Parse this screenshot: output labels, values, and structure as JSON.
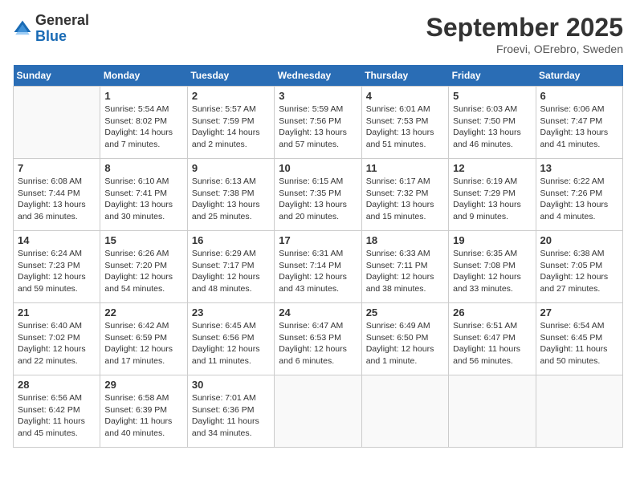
{
  "header": {
    "logo_general": "General",
    "logo_blue": "Blue",
    "month_title": "September 2025",
    "subtitle": "Froevi, OErebro, Sweden"
  },
  "days_of_week": [
    "Sunday",
    "Monday",
    "Tuesday",
    "Wednesday",
    "Thursday",
    "Friday",
    "Saturday"
  ],
  "weeks": [
    [
      {
        "day": "",
        "sunrise": "",
        "sunset": "",
        "daylight": ""
      },
      {
        "day": "1",
        "sunrise": "Sunrise: 5:54 AM",
        "sunset": "Sunset: 8:02 PM",
        "daylight": "Daylight: 14 hours and 7 minutes."
      },
      {
        "day": "2",
        "sunrise": "Sunrise: 5:57 AM",
        "sunset": "Sunset: 7:59 PM",
        "daylight": "Daylight: 14 hours and 2 minutes."
      },
      {
        "day": "3",
        "sunrise": "Sunrise: 5:59 AM",
        "sunset": "Sunset: 7:56 PM",
        "daylight": "Daylight: 13 hours and 57 minutes."
      },
      {
        "day": "4",
        "sunrise": "Sunrise: 6:01 AM",
        "sunset": "Sunset: 7:53 PM",
        "daylight": "Daylight: 13 hours and 51 minutes."
      },
      {
        "day": "5",
        "sunrise": "Sunrise: 6:03 AM",
        "sunset": "Sunset: 7:50 PM",
        "daylight": "Daylight: 13 hours and 46 minutes."
      },
      {
        "day": "6",
        "sunrise": "Sunrise: 6:06 AM",
        "sunset": "Sunset: 7:47 PM",
        "daylight": "Daylight: 13 hours and 41 minutes."
      }
    ],
    [
      {
        "day": "7",
        "sunrise": "Sunrise: 6:08 AM",
        "sunset": "Sunset: 7:44 PM",
        "daylight": "Daylight: 13 hours and 36 minutes."
      },
      {
        "day": "8",
        "sunrise": "Sunrise: 6:10 AM",
        "sunset": "Sunset: 7:41 PM",
        "daylight": "Daylight: 13 hours and 30 minutes."
      },
      {
        "day": "9",
        "sunrise": "Sunrise: 6:13 AM",
        "sunset": "Sunset: 7:38 PM",
        "daylight": "Daylight: 13 hours and 25 minutes."
      },
      {
        "day": "10",
        "sunrise": "Sunrise: 6:15 AM",
        "sunset": "Sunset: 7:35 PM",
        "daylight": "Daylight: 13 hours and 20 minutes."
      },
      {
        "day": "11",
        "sunrise": "Sunrise: 6:17 AM",
        "sunset": "Sunset: 7:32 PM",
        "daylight": "Daylight: 13 hours and 15 minutes."
      },
      {
        "day": "12",
        "sunrise": "Sunrise: 6:19 AM",
        "sunset": "Sunset: 7:29 PM",
        "daylight": "Daylight: 13 hours and 9 minutes."
      },
      {
        "day": "13",
        "sunrise": "Sunrise: 6:22 AM",
        "sunset": "Sunset: 7:26 PM",
        "daylight": "Daylight: 13 hours and 4 minutes."
      }
    ],
    [
      {
        "day": "14",
        "sunrise": "Sunrise: 6:24 AM",
        "sunset": "Sunset: 7:23 PM",
        "daylight": "Daylight: 12 hours and 59 minutes."
      },
      {
        "day": "15",
        "sunrise": "Sunrise: 6:26 AM",
        "sunset": "Sunset: 7:20 PM",
        "daylight": "Daylight: 12 hours and 54 minutes."
      },
      {
        "day": "16",
        "sunrise": "Sunrise: 6:29 AM",
        "sunset": "Sunset: 7:17 PM",
        "daylight": "Daylight: 12 hours and 48 minutes."
      },
      {
        "day": "17",
        "sunrise": "Sunrise: 6:31 AM",
        "sunset": "Sunset: 7:14 PM",
        "daylight": "Daylight: 12 hours and 43 minutes."
      },
      {
        "day": "18",
        "sunrise": "Sunrise: 6:33 AM",
        "sunset": "Sunset: 7:11 PM",
        "daylight": "Daylight: 12 hours and 38 minutes."
      },
      {
        "day": "19",
        "sunrise": "Sunrise: 6:35 AM",
        "sunset": "Sunset: 7:08 PM",
        "daylight": "Daylight: 12 hours and 33 minutes."
      },
      {
        "day": "20",
        "sunrise": "Sunrise: 6:38 AM",
        "sunset": "Sunset: 7:05 PM",
        "daylight": "Daylight: 12 hours and 27 minutes."
      }
    ],
    [
      {
        "day": "21",
        "sunrise": "Sunrise: 6:40 AM",
        "sunset": "Sunset: 7:02 PM",
        "daylight": "Daylight: 12 hours and 22 minutes."
      },
      {
        "day": "22",
        "sunrise": "Sunrise: 6:42 AM",
        "sunset": "Sunset: 6:59 PM",
        "daylight": "Daylight: 12 hours and 17 minutes."
      },
      {
        "day": "23",
        "sunrise": "Sunrise: 6:45 AM",
        "sunset": "Sunset: 6:56 PM",
        "daylight": "Daylight: 12 hours and 11 minutes."
      },
      {
        "day": "24",
        "sunrise": "Sunrise: 6:47 AM",
        "sunset": "Sunset: 6:53 PM",
        "daylight": "Daylight: 12 hours and 6 minutes."
      },
      {
        "day": "25",
        "sunrise": "Sunrise: 6:49 AM",
        "sunset": "Sunset: 6:50 PM",
        "daylight": "Daylight: 12 hours and 1 minute."
      },
      {
        "day": "26",
        "sunrise": "Sunrise: 6:51 AM",
        "sunset": "Sunset: 6:47 PM",
        "daylight": "Daylight: 11 hours and 56 minutes."
      },
      {
        "day": "27",
        "sunrise": "Sunrise: 6:54 AM",
        "sunset": "Sunset: 6:45 PM",
        "daylight": "Daylight: 11 hours and 50 minutes."
      }
    ],
    [
      {
        "day": "28",
        "sunrise": "Sunrise: 6:56 AM",
        "sunset": "Sunset: 6:42 PM",
        "daylight": "Daylight: 11 hours and 45 minutes."
      },
      {
        "day": "29",
        "sunrise": "Sunrise: 6:58 AM",
        "sunset": "Sunset: 6:39 PM",
        "daylight": "Daylight: 11 hours and 40 minutes."
      },
      {
        "day": "30",
        "sunrise": "Sunrise: 7:01 AM",
        "sunset": "Sunset: 6:36 PM",
        "daylight": "Daylight: 11 hours and 34 minutes."
      },
      {
        "day": "",
        "sunrise": "",
        "sunset": "",
        "daylight": ""
      },
      {
        "day": "",
        "sunrise": "",
        "sunset": "",
        "daylight": ""
      },
      {
        "day": "",
        "sunrise": "",
        "sunset": "",
        "daylight": ""
      },
      {
        "day": "",
        "sunrise": "",
        "sunset": "",
        "daylight": ""
      }
    ]
  ]
}
